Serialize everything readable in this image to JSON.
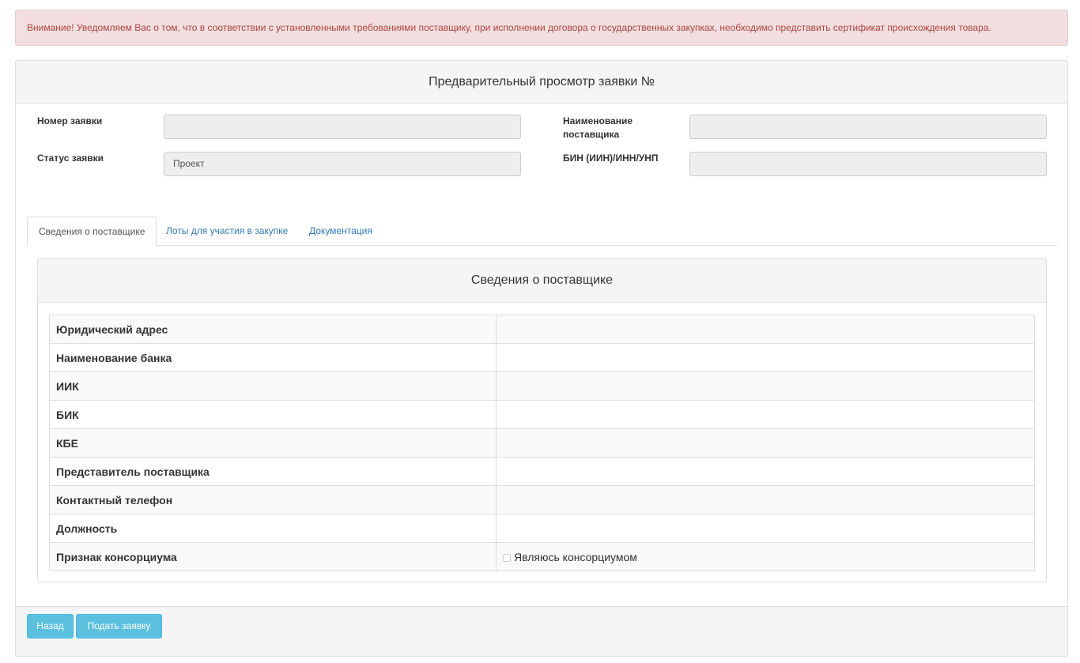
{
  "alert": {
    "text": "Внимание! Уведомляем Вас о том, что в соответствии с установленными требованиями поставщику, при исполнении договора о государственных закупках, необходимо представить сертификат происхождения товара."
  },
  "panel": {
    "title": "Предварительный просмотр заявки №"
  },
  "form": {
    "number_label": "Номер заявки",
    "number_value": "",
    "status_label": "Статус заявки",
    "status_value": "Проект",
    "supplier_name_label_1": "Наименование",
    "supplier_name_label_2": "поставщика",
    "supplier_name_value": "",
    "bin_label": "БИН (ИИН)/ИНН/УНП",
    "bin_value": ""
  },
  "tabs": [
    {
      "label": "Сведения о поставщике",
      "active": true
    },
    {
      "label": "Лоты для участия в закупке",
      "active": false
    },
    {
      "label": "Документация",
      "active": false
    }
  ],
  "supplier_info": {
    "title": "Сведения о поставщике",
    "rows": [
      {
        "label": "Юридический адрес",
        "value": ""
      },
      {
        "label": "Наименование банка",
        "value": ""
      },
      {
        "label": "ИИК",
        "value": ""
      },
      {
        "label": "БИК",
        "value": ""
      },
      {
        "label": "КБЕ",
        "value": ""
      },
      {
        "label": "Представитель поставщика",
        "value": ""
      },
      {
        "label": "Контактный телефон",
        "value": ""
      },
      {
        "label": "Должность",
        "value": ""
      },
      {
        "label": "Признак консорциума",
        "value": ""
      }
    ],
    "consortium_checkbox_label": "Являюсь консорциумом"
  },
  "footer": {
    "back_label": "Назад",
    "submit_label": "Подать заявку"
  },
  "colors": {
    "alert_bg": "#f2dede",
    "alert_text": "#a94442",
    "link": "#337ab7",
    "button_info": "#5bc0de"
  }
}
